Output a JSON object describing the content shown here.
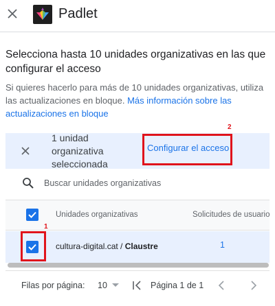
{
  "app": {
    "title": "Padlet"
  },
  "intro": {
    "heading": "Selecciona hasta 10 unidades organizativas en las que configurar el acceso",
    "description": "Si quieres hacerlo para más de 10 unidades organizativas, utiliza las actualizaciones en bloque.",
    "link": "Más información sobre las actualizaciones en bloque"
  },
  "selection": {
    "count_text": "1 unidad organizativa seleccionada",
    "configure_label": "Configurar el acceso"
  },
  "annotations": {
    "configure_marker": "2",
    "checkbox_marker": "1"
  },
  "search": {
    "placeholder": "Buscar unidades organizativas"
  },
  "table": {
    "columns": [
      "Unidades organizativas",
      "Solicitudes de usuario"
    ],
    "rows": [
      {
        "unit_prefix": "cultura-digital.cat / ",
        "unit_name": "Claustre",
        "requests": "1",
        "checked": true
      }
    ]
  },
  "pagination": {
    "rows_per_page_label": "Filas por página:",
    "rows_per_page_value": "10",
    "page_info": "Página 1 de 1"
  },
  "colors": {
    "accent": "#1a73e8",
    "selection_bg": "#e8f0fe",
    "highlight": "#e0131b"
  }
}
